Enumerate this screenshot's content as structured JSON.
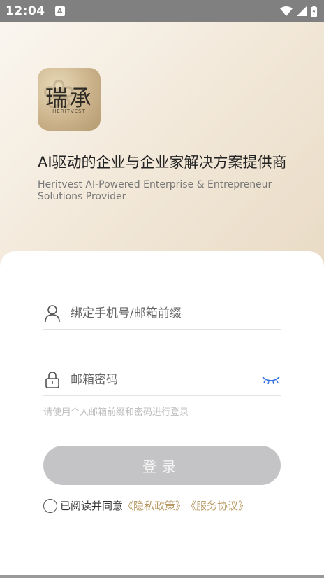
{
  "status": {
    "time": "12:04",
    "notif_letter": "A"
  },
  "logo": {
    "mark": "瑞承",
    "sub": "HERITVEST"
  },
  "headline": "AI驱动的企业与企业家解决方案提供商",
  "subline": "Heritvest AI-Powered Enterprise & Entrepreneur Solutions Provider",
  "form": {
    "account_placeholder": "绑定手机号/邮箱前缀",
    "password_placeholder": "邮箱密码",
    "hint": "请使用个人邮箱前缀和密码进行登录",
    "login_label": "登录",
    "agree_text": "已阅读并同意",
    "privacy_link": "《隐私政策》",
    "service_link": "《服务协议》"
  },
  "colors": {
    "accent": "#b89a66",
    "button": "#c4c4c6"
  }
}
